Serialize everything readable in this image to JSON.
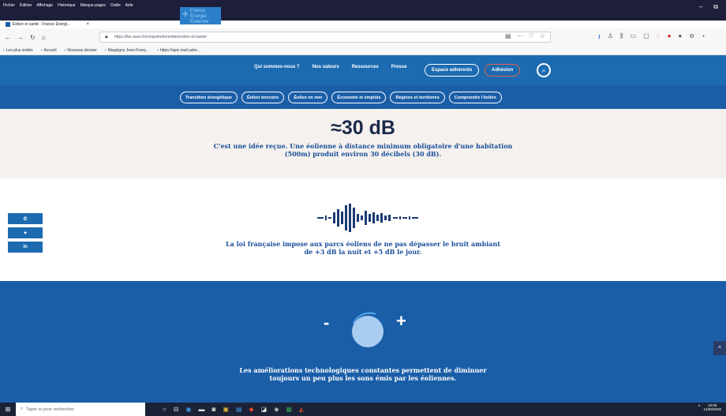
{
  "browser": {
    "menus": [
      "Fichier",
      "Édition",
      "Affichage",
      "Historique",
      "Marque-pages",
      "Outils",
      "Aide"
    ],
    "tab_title": "Éolien et santé - France Énergi...",
    "tab_close": "×",
    "new_tab": "+",
    "url": "https://fee.asso.fr/comprendre/eolien/eolien-et-sante/",
    "url_actions": [
      "▤",
      "⋯",
      "♡",
      "☆"
    ],
    "extensions": [
      "⭳",
      "♙",
      "⫼",
      "▭",
      "▢",
      "◌",
      "●",
      "●",
      "⊖",
      "⋆"
    ],
    "bookmarks": [
      "Les plus visités",
      "Accueil",
      "Nouveau dossier",
      "Maupigny Jean-Franç...",
      "https://apic.mail.yaho..."
    ],
    "window_buttons": [
      "–",
      "⧉",
      "✕"
    ]
  },
  "site": {
    "logo_lines": [
      "France",
      "Énergie",
      "Éolienne"
    ],
    "nav": [
      "Qui sommes-nous ?",
      "Nos valeurs",
      "Ressources",
      "Presse"
    ],
    "espace_label": "Espace adhérents",
    "adhesion_label": "Adhésion",
    "search_glyph": "⌕",
    "subnav": [
      "Transition énergétique",
      "Éolien terrestre",
      "Éolien en mer",
      "Économie et emplois",
      "Régions et territoires",
      "Comprendre l'éolien"
    ]
  },
  "content": {
    "big_stat": "≈30 dB",
    "stat_desc": "C'est une idée reçue. Une éolienne à distance minimum obligatoire d'une habitation (500m) produit environ 30 décibels (30 dB).",
    "law_text": "La loi française impose aux parcs éoliens de ne pas dépasser le bruit ambiant de +3 dB la nuit et +5 dB le jour.",
    "minus": "-",
    "plus": "+",
    "tech_text": "Les améliorations technologiques constantes permettent de diminuer toujours un peu plus les sons émis par les éoliennes.",
    "scroll_top": "^"
  },
  "share": [
    {
      "glyph": "✆"
    },
    {
      "glyph": "✦"
    },
    {
      "glyph": "in"
    }
  ],
  "taskbar": {
    "start": "⊞",
    "search_placeholder": "Taper ici pour rechercher",
    "apps": [
      "○",
      "⊟",
      "◉",
      "▬",
      "◙",
      "▣",
      "▤",
      "◆",
      "◪",
      "◈",
      "▦",
      "◭"
    ],
    "tray_chevron": "^",
    "time": "10:05",
    "date": "14/08/2020"
  },
  "colors": {
    "header_blue": "#1c6bb1",
    "subnav_blue": "#1b5ea8",
    "text_blue": "#1a4e9a",
    "adhesion_border": "#e3634d",
    "knob_light": "#a9cdf0"
  }
}
